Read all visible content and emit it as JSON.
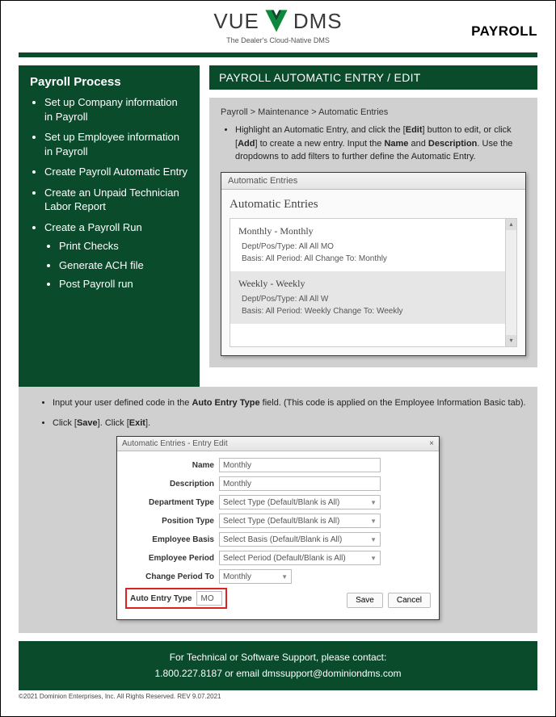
{
  "header": {
    "logo_left": "VUE",
    "logo_right": "DMS",
    "tagline": "The Dealer's Cloud-Native DMS",
    "title": "PAYROLL"
  },
  "sidebar": {
    "heading": "Payroll Process",
    "items": [
      "Set up Company information in Payroll",
      "Set up Employee information in Payroll",
      "Create Payroll Automatic Entry",
      "Create an Unpaid Technician Labor Report",
      "Create a Payroll Run"
    ],
    "subitems": [
      "Print Checks",
      "Generate ACH file",
      "Post Payroll run"
    ]
  },
  "section": {
    "title": "PAYROLL AUTOMATIC ENTRY / EDIT",
    "breadcrumb": "Payroll > Maintenance > Automatic Entries",
    "instr1_pre": "Highlight an Automatic Entry, and click the [",
    "instr1_b1": "Edit",
    "instr1_mid1": "] button to edit, or click [",
    "instr1_b2": "Add",
    "instr1_mid2": "] to create a new entry. Input the ",
    "instr1_b3": "Name",
    "instr1_mid3": " and ",
    "instr1_b4": "Description",
    "instr1_post": ". Use the dropdowns to add filters to further define the Automatic Entry."
  },
  "list_window": {
    "title": "Automatic Entries",
    "heading": "Automatic Entries",
    "entries": [
      {
        "title": "Monthly - Monthly",
        "line1": "Dept/Pos/Type: All  All  MO",
        "line2": "Basis: All   Period: All   Change To: Monthly",
        "selected": false
      },
      {
        "title": "Weekly - Weekly",
        "line1": "Dept/Pos/Type: All  All  W",
        "line2": "Basis: All   Period: Weekly   Change To: Weekly",
        "selected": true
      }
    ]
  },
  "below": {
    "instr1_pre": "Input your user defined code in the ",
    "instr1_b": "Auto Entry Type",
    "instr1_post": " field. (This code is applied on the Employee Information Basic tab).",
    "instr2_pre": "Click [",
    "instr2_b1": "Save",
    "instr2_mid": "].  Click [",
    "instr2_b2": "Exit",
    "instr2_post": "]."
  },
  "edit_window": {
    "title": "Automatic Entries - Entry Edit",
    "fields": {
      "name_label": "Name",
      "name_value": "Monthly",
      "desc_label": "Description",
      "desc_value": "Monthly",
      "dept_label": "Department Type",
      "dept_value": "Select Type (Default/Blank is All)",
      "pos_label": "Position Type",
      "pos_value": "Select Type (Default/Blank is All)",
      "basis_label": "Employee Basis",
      "basis_value": "Select Basis (Default/Blank is All)",
      "period_label": "Employee Period",
      "period_value": "Select Period (Default/Blank is All)",
      "change_label": "Change Period To",
      "change_value": "Monthly",
      "autotype_label": "Auto Entry Type",
      "autotype_value": "MO"
    },
    "save": "Save",
    "cancel": "Cancel"
  },
  "footer": {
    "line1": "For Technical or Software Support, please contact:",
    "line2": "1.800.227.8187 or email dmssupport@dominiondms.com"
  },
  "copyright": "©2021 Dominion Enterprises, Inc. All Rights Reserved. REV 9.07.2021"
}
